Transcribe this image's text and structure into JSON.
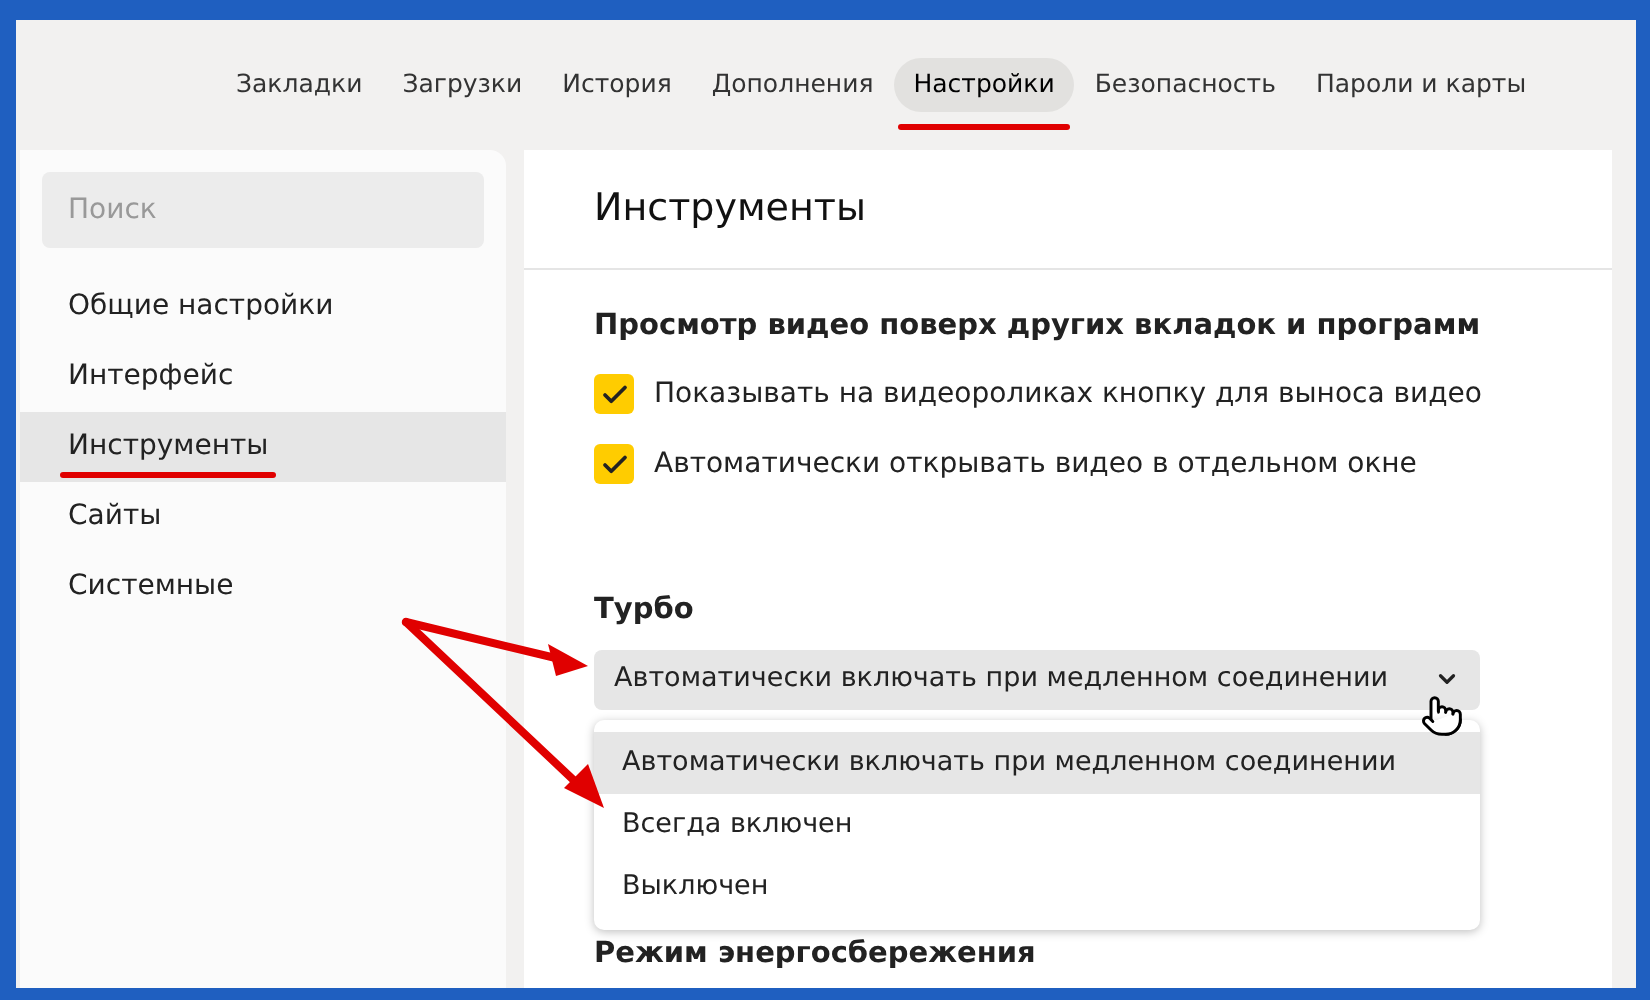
{
  "nav": {
    "tabs": [
      {
        "label": "Закладки",
        "selected": false
      },
      {
        "label": "Загрузки",
        "selected": false
      },
      {
        "label": "История",
        "selected": false
      },
      {
        "label": "Дополнения",
        "selected": false
      },
      {
        "label": "Настройки",
        "selected": true
      },
      {
        "label": "Безопасность",
        "selected": false
      },
      {
        "label": "Пароли и карты",
        "selected": false
      }
    ]
  },
  "sidebar": {
    "search": {
      "placeholder": "Поиск"
    },
    "items": [
      {
        "label": "Общие настройки",
        "selected": false
      },
      {
        "label": "Интерфейс",
        "selected": false
      },
      {
        "label": "Инструменты",
        "selected": true
      },
      {
        "label": "Сайты",
        "selected": false
      },
      {
        "label": "Системные",
        "selected": false
      }
    ]
  },
  "content": {
    "title": "Инструменты",
    "video": {
      "heading": "Просмотр видео поверх других вкладок и программ",
      "options": [
        {
          "label": "Показывать на видеороликах кнопку для выноса видео",
          "checked": true
        },
        {
          "label": "Автоматически открывать видео в отдельном окне",
          "checked": true
        }
      ]
    },
    "turbo": {
      "heading": "Турбо",
      "select": {
        "value": "Автоматически включать при медленном соединении",
        "expanded": true,
        "options": [
          {
            "label": "Автоматически включать при медленном соединении",
            "selected": true
          },
          {
            "label": "Всегда включен",
            "selected": false
          },
          {
            "label": "Выключен",
            "selected": false
          }
        ]
      }
    },
    "energy": {
      "heading": "Режим энергосбережения"
    }
  }
}
